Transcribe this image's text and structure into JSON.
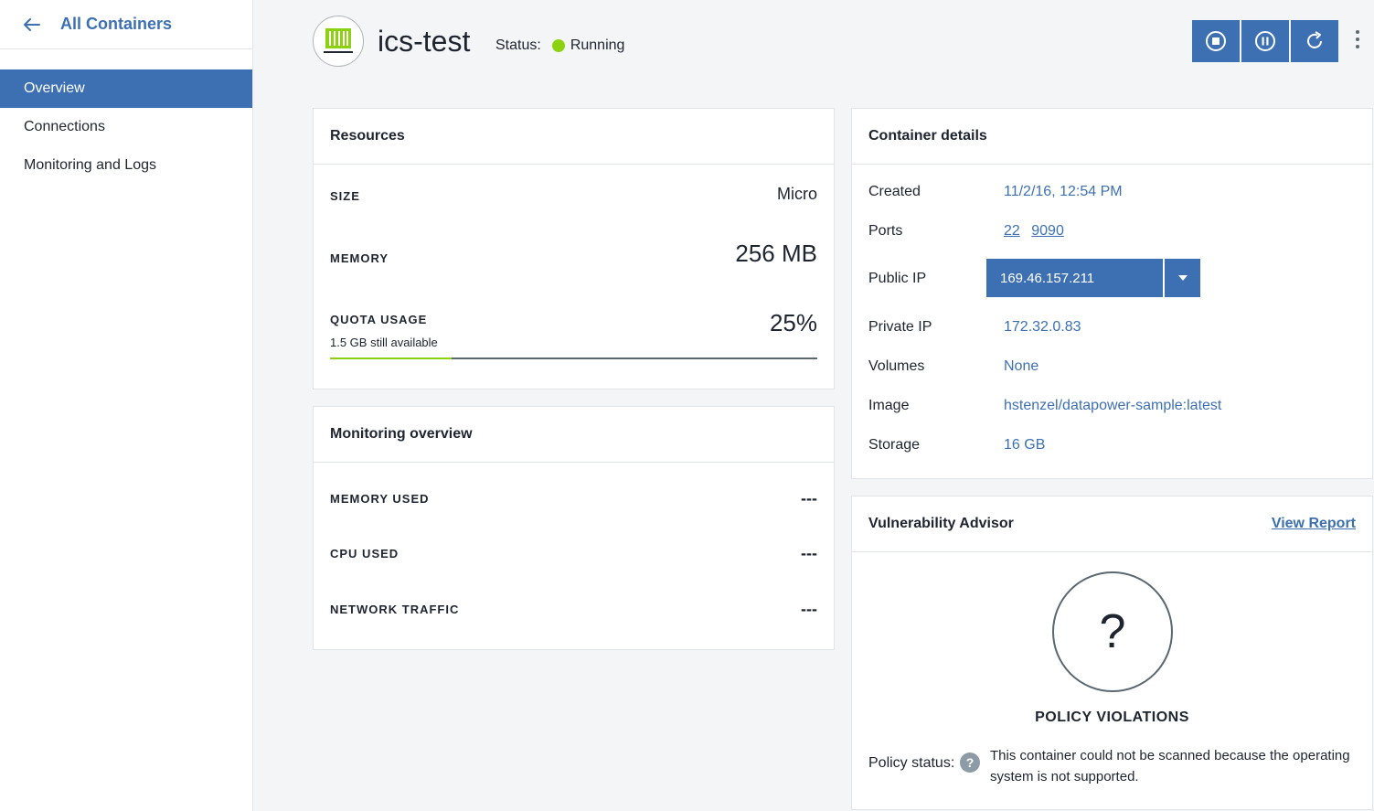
{
  "sidebar": {
    "back_label": "All Containers",
    "items": [
      {
        "label": "Overview",
        "active": true
      },
      {
        "label": "Connections",
        "active": false
      },
      {
        "label": "Monitoring and Logs",
        "active": false
      }
    ]
  },
  "header": {
    "title": "ics-test",
    "status_label": "Status:",
    "status_value": "Running",
    "status_color": "#8cd211",
    "actions": [
      "stop-icon",
      "pause-icon",
      "restart-icon"
    ]
  },
  "resources": {
    "title": "Resources",
    "size_label": "SIZE",
    "size_value": "Micro",
    "memory_label": "MEMORY",
    "memory_value": "256 MB",
    "quota_label": "QUOTA USAGE",
    "quota_sub": "1.5 GB still available",
    "quota_value": "25%",
    "quota_fraction": 0.25
  },
  "monitoring": {
    "title": "Monitoring overview",
    "rows": [
      {
        "label": "MEMORY USED",
        "value": "---"
      },
      {
        "label": "CPU USED",
        "value": "---"
      },
      {
        "label": "NETWORK TRAFFIC",
        "value": "---"
      }
    ]
  },
  "details": {
    "title": "Container details",
    "created_label": "Created",
    "created_value": "11/2/16, 12:54 PM",
    "ports_label": "Ports",
    "ports": [
      "22",
      "9090"
    ],
    "public_ip_label": "Public IP",
    "public_ip_value": "169.46.157.211",
    "private_ip_label": "Private IP",
    "private_ip_value": "172.32.0.83",
    "volumes_label": "Volumes",
    "volumes_value": "None",
    "image_label": "Image",
    "image_value": "hstenzel/datapower-sample:latest",
    "storage_label": "Storage",
    "storage_value": "16 GB"
  },
  "vulnerability": {
    "title": "Vulnerability Advisor",
    "view_report": "View Report",
    "circle_symbol": "?",
    "violations_title": "POLICY VIOLATIONS",
    "policy_status_label": "Policy status:",
    "policy_help": "?",
    "policy_status_text": "This container could not be scanned because the operating system is not supported."
  },
  "colors": {
    "accent": "#3d70b2",
    "progress": "#8cd211"
  }
}
